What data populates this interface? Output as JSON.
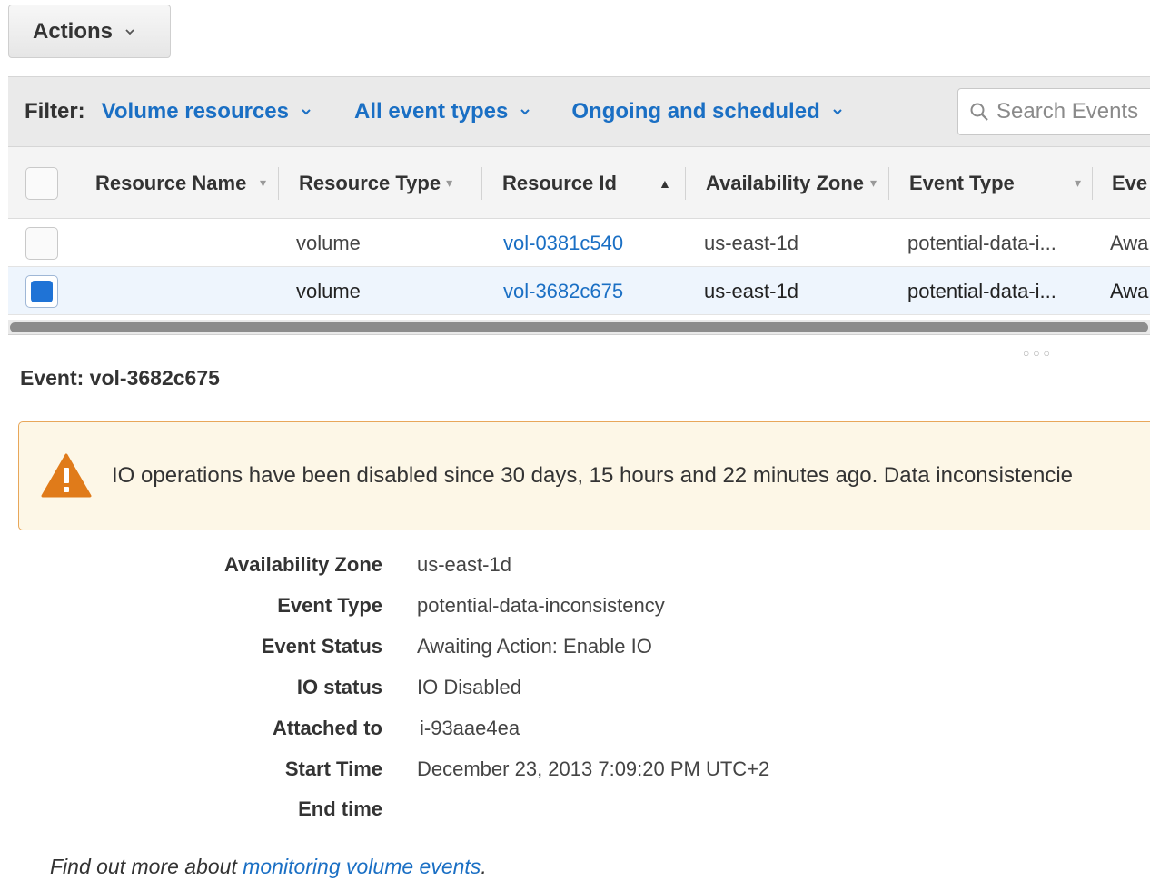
{
  "toolbar": {
    "actions_label": "Actions"
  },
  "filter": {
    "label": "Filter:",
    "resource_filter": "Volume resources",
    "event_type_filter": "All event types",
    "status_filter": "Ongoing and scheduled",
    "search_placeholder": "Search Events"
  },
  "table": {
    "columns": [
      "Resource Name",
      "Resource Type",
      "Resource Id",
      "Availability Zone",
      "Event Type",
      "Eve"
    ],
    "rows": [
      {
        "selected": false,
        "resource_name": "",
        "resource_type": "volume",
        "resource_id": "vol-0381c540",
        "availability_zone": "us-east-1d",
        "event_type": "potential-data-i...",
        "event_status": "Awa"
      },
      {
        "selected": true,
        "resource_name": "",
        "resource_type": "volume",
        "resource_id": "vol-3682c675",
        "availability_zone": "us-east-1d",
        "event_type": "potential-data-i...",
        "event_status": "Awa"
      }
    ]
  },
  "event": {
    "title": "Event: vol-3682c675",
    "alert": "IO operations have been disabled since 30 days, 15 hours and 22 minutes ago. Data inconsistencie",
    "details": [
      {
        "label": "Availability Zone",
        "value": "us-east-1d"
      },
      {
        "label": "Event Type",
        "value": "potential-data-inconsistency"
      },
      {
        "label": "Event Status",
        "value": "Awaiting Action: Enable IO"
      },
      {
        "label": "IO status",
        "value": "IO Disabled"
      },
      {
        "label": "Attached to",
        "value": "i-93aae4ea"
      },
      {
        "label": "Start Time",
        "value": "December 23, 2013 7:09:20 PM UTC+2"
      },
      {
        "label": "End time",
        "value": ""
      }
    ]
  },
  "footer": {
    "prefix": "Find out more about",
    "link": "monitoring volume events",
    "suffix": "."
  },
  "colors": {
    "link": "#1a6fc4",
    "selected_checkbox": "#1f73d6",
    "alert_border": "#e8a75a",
    "alert_icon": "#e07b1a"
  }
}
